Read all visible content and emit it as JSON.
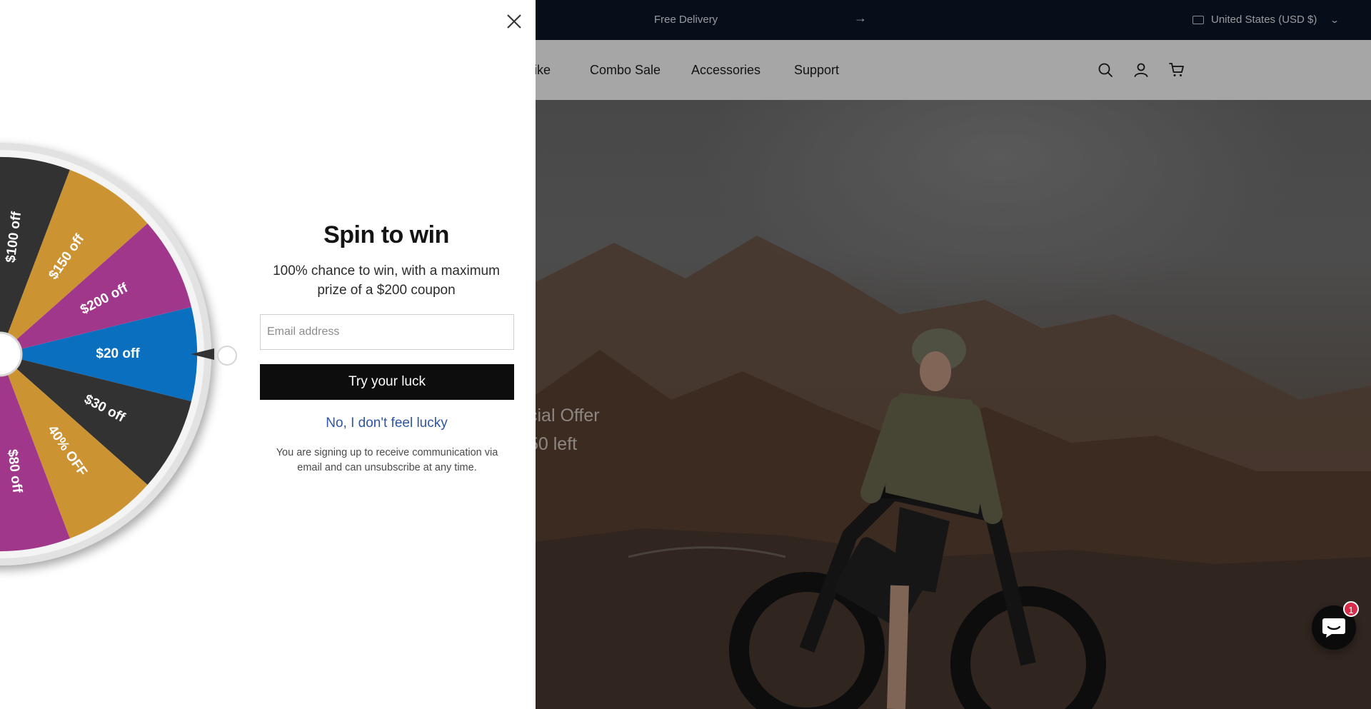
{
  "announcement": {
    "message": "Free Delivery",
    "arrow": "→",
    "region": "United States (USD $)"
  },
  "nav": {
    "links": [
      "bike",
      "Combo Sale",
      "Accessories",
      "Support"
    ],
    "icons": [
      "search-icon",
      "account-icon",
      "cart-icon"
    ]
  },
  "hero": {
    "line1": "cial Offer",
    "line2": "50 left"
  },
  "popup": {
    "title": "Spin to win",
    "subtitle": "100% chance to win, with a maximum prize of a $200 coupon",
    "email_placeholder": "Email address",
    "button": "Try your luck",
    "decline": "No, I don't feel lucky",
    "disclaimer": "You are signing up to receive communication via email and can unsubscribe at any time."
  },
  "wheel": {
    "slices": [
      {
        "label": "$20 off",
        "color": "#0a6fbf"
      },
      {
        "label": "$30 off",
        "color": "#323232"
      },
      {
        "label": "40% OFF",
        "color": "#cc9333"
      },
      {
        "label": "$80 off",
        "color": "#a1378b"
      },
      {
        "label": "",
        "color": "#323232"
      },
      {
        "label": "",
        "color": "#cc9333"
      },
      {
        "label": "",
        "color": "#a1378b"
      },
      {
        "label": "",
        "color": "#323232"
      },
      {
        "label": "",
        "color": "#0a6fbf"
      },
      {
        "label": "",
        "color": "#a1378b"
      },
      {
        "label": "$100 off",
        "color": "#323232"
      },
      {
        "label": "$150 off",
        "color": "#cc9333"
      },
      {
        "label": "$200 off",
        "color": "#a1378b"
      }
    ]
  },
  "chat": {
    "badge": "1"
  },
  "colors": {
    "announcement_bg": "#0a1628",
    "decline_link": "#2f55a6",
    "primary_button": "#0d0d0d"
  }
}
